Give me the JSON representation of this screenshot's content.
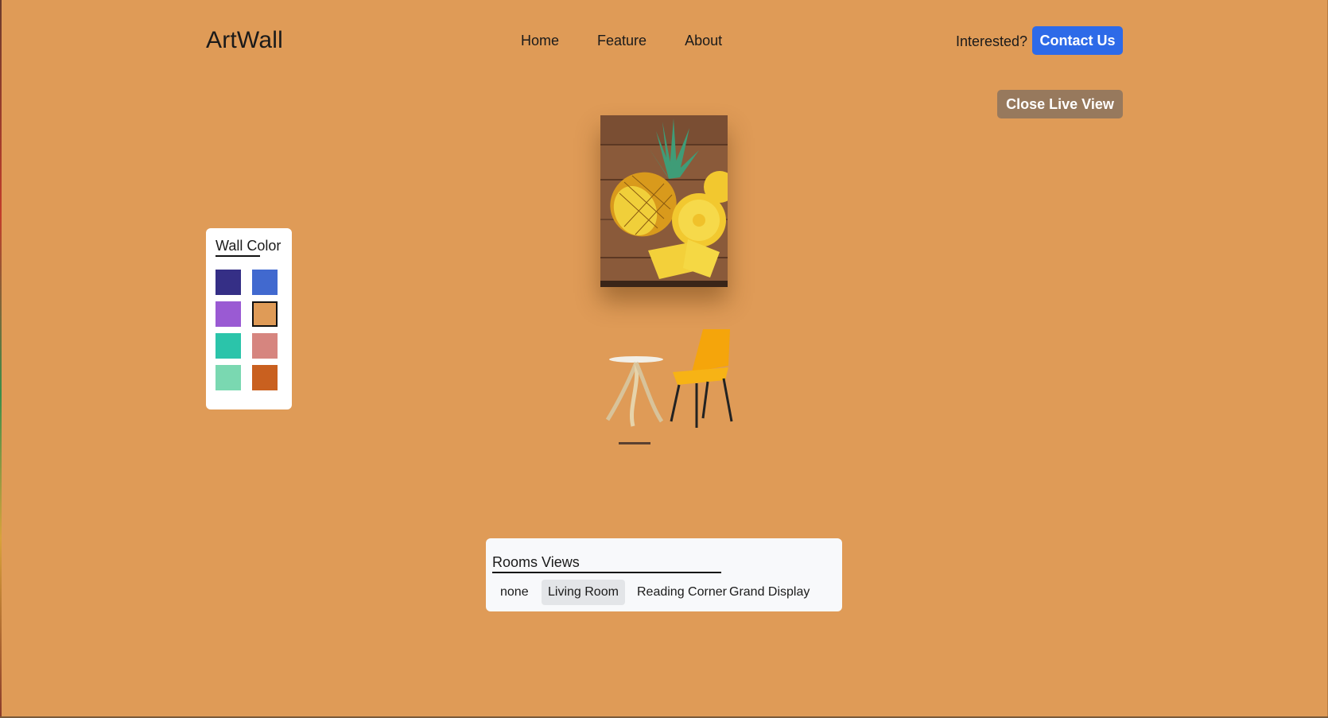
{
  "header": {
    "logo": "ArtWall",
    "nav": [
      "Home",
      "Feature",
      "About"
    ],
    "interested_text": "Interested?",
    "contact_label": "Contact Us"
  },
  "close_live_view_label": "Close Live View",
  "wall_color": {
    "title": "Wall Color",
    "selected": "#df9b57",
    "swatches": [
      "#352f86",
      "#4169cf",
      "#9a5ad3",
      "#df9b57",
      "#2bc4aa",
      "#d6857f",
      "#7ad8b1",
      "#c9601f"
    ]
  },
  "painting": {
    "icon": "pineapple-artwork"
  },
  "furniture": {
    "icon": "table-and-chair"
  },
  "rooms": {
    "title": "Rooms Views",
    "tabs": [
      "none",
      "Living Room",
      "Reading Corner",
      "Grand Display"
    ],
    "active": "Living Room"
  },
  "colors": {
    "accent": "#2d6ae8",
    "close_button": "#97795d"
  }
}
